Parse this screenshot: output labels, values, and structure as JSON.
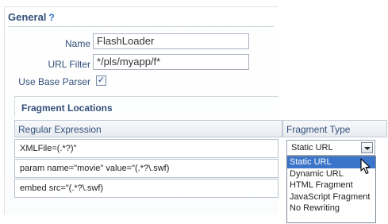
{
  "general": {
    "title": "General",
    "help_glyph": "?",
    "name_label": "Name",
    "name_value": "FlashLoader",
    "url_filter_label": "URL Filter",
    "url_filter_value": "*/pls/myapp/f*",
    "base_parser_label": "Use Base Parser",
    "base_parser_checked": true,
    "check_glyph": "✓"
  },
  "fragments": {
    "title": "Fragment Locations",
    "columns": {
      "regex": "Regular Expression",
      "type": "Fragment Type"
    },
    "rows": [
      {
        "regex": "XMLFile=(.*?)\""
      },
      {
        "regex": "param name=\"movie\" value=\"(.*?\\.swf)"
      },
      {
        "regex": "embed src=\"(.*?\\.swf)"
      }
    ]
  },
  "type_select": {
    "value": "Static URL",
    "options": [
      "Static URL",
      "Dynamic URL",
      "HTML Fragment",
      "JavaScript Fragment",
      "No Rewriting"
    ],
    "highlighted": "Static URL"
  },
  "colors": {
    "label": "#33507a",
    "highlight": "#3b75c9",
    "help_icon": "#2d6fc2"
  },
  "icons": {
    "help": "help-icon",
    "dropdown": "chevron-down-icon",
    "cursor": "mouse-pointer-icon"
  }
}
